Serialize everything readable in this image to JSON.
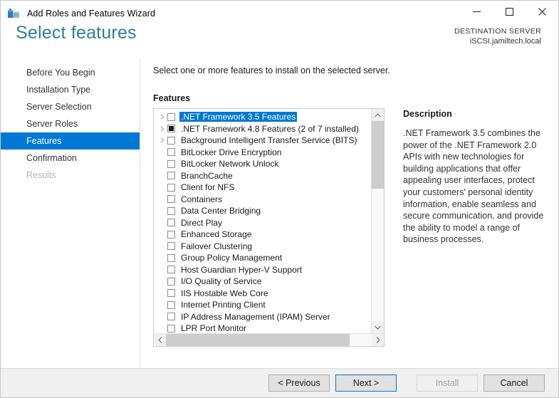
{
  "window": {
    "title": "Add Roles and Features Wizard",
    "icon": "server-toolbox-icon",
    "caption": {
      "minimize": "minimize-icon",
      "maximize": "maximize-icon",
      "close": "close-icon"
    }
  },
  "header": {
    "page_title": "Select features",
    "destination_label": "DESTINATION SERVER",
    "destination_server": "iSCSI.jamiltech.local",
    "title_color": "#2e7d9a"
  },
  "sidebar": {
    "accent_color": "#0078d4",
    "items": [
      {
        "label": "Before You Begin",
        "state": "normal"
      },
      {
        "label": "Installation Type",
        "state": "normal"
      },
      {
        "label": "Server Selection",
        "state": "normal"
      },
      {
        "label": "Server Roles",
        "state": "normal"
      },
      {
        "label": "Features",
        "state": "active"
      },
      {
        "label": "Confirmation",
        "state": "normal"
      },
      {
        "label": "Results",
        "state": "disabled"
      }
    ]
  },
  "main": {
    "instruction": "Select one or more features to install on the selected server.",
    "features_label": "Features",
    "features": [
      {
        "label": ".NET Framework 3.5 Features",
        "expander": true,
        "check": "unchecked",
        "selected": true
      },
      {
        "label": ".NET Framework 4.8 Features (2 of 7 installed)",
        "expander": true,
        "check": "partial",
        "selected": false
      },
      {
        "label": "Background Intelligent Transfer Service (BITS)",
        "expander": true,
        "check": "unchecked",
        "selected": false
      },
      {
        "label": "BitLocker Drive Encryption",
        "expander": false,
        "check": "unchecked",
        "selected": false
      },
      {
        "label": "BitLocker Network Unlock",
        "expander": false,
        "check": "unchecked",
        "selected": false
      },
      {
        "label": "BranchCache",
        "expander": false,
        "check": "unchecked",
        "selected": false
      },
      {
        "label": "Client for NFS",
        "expander": false,
        "check": "unchecked",
        "selected": false
      },
      {
        "label": "Containers",
        "expander": false,
        "check": "unchecked",
        "selected": false
      },
      {
        "label": "Data Center Bridging",
        "expander": false,
        "check": "unchecked",
        "selected": false
      },
      {
        "label": "Direct Play",
        "expander": false,
        "check": "unchecked",
        "selected": false
      },
      {
        "label": "Enhanced Storage",
        "expander": false,
        "check": "unchecked",
        "selected": false
      },
      {
        "label": "Failover Clustering",
        "expander": false,
        "check": "unchecked",
        "selected": false
      },
      {
        "label": "Group Policy Management",
        "expander": false,
        "check": "unchecked",
        "selected": false
      },
      {
        "label": "Host Guardian Hyper-V Support",
        "expander": false,
        "check": "unchecked",
        "selected": false
      },
      {
        "label": "I/O Quality of Service",
        "expander": false,
        "check": "unchecked",
        "selected": false
      },
      {
        "label": "IIS Hostable Web Core",
        "expander": false,
        "check": "unchecked",
        "selected": false
      },
      {
        "label": "Internet Printing Client",
        "expander": false,
        "check": "unchecked",
        "selected": false
      },
      {
        "label": "IP Address Management (IPAM) Server",
        "expander": false,
        "check": "unchecked",
        "selected": false
      },
      {
        "label": "LPR Port Monitor",
        "expander": false,
        "check": "unchecked",
        "selected": false
      }
    ]
  },
  "description": {
    "title": "Description",
    "text": ".NET Framework 3.5 combines the power of the .NET Framework 2.0 APIs with new technologies for building applications that offer appealing user interfaces, protect your customers' personal identity information, enable seamless and secure communication, and provide the ability to model a range of business processes."
  },
  "footer": {
    "previous": "< Previous",
    "next": "Next >",
    "install": "Install",
    "cancel": "Cancel",
    "focus_color": "#0078d4"
  }
}
